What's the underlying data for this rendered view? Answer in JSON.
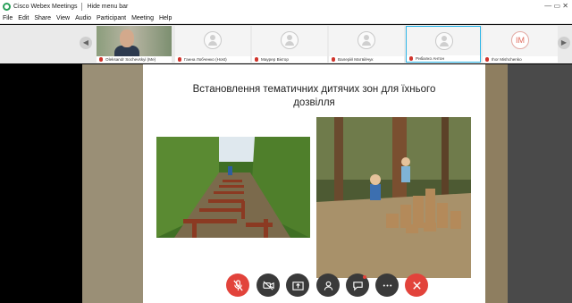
{
  "window": {
    "app_title": "Cisco Webex Meetings",
    "hide_menu_label": "Hide menu bar",
    "controls": "— ▭ ✕"
  },
  "menu": [
    "File",
    "Edit",
    "Share",
    "View",
    "Audio",
    "Participant",
    "Meeting",
    "Help"
  ],
  "participants": [
    {
      "name": "Oleksandr Sochevskyi (Me)",
      "type": "video",
      "muted": true
    },
    {
      "name": "Ганна Лобченко (Host)",
      "type": "avatar",
      "muted": true
    },
    {
      "name": "Маурер Віктор",
      "type": "avatar",
      "muted": true
    },
    {
      "name": "Валерій Матвійчук",
      "type": "avatar",
      "muted": true
    },
    {
      "name": "Рибалко Антон",
      "type": "avatar",
      "muted": true,
      "active": true
    },
    {
      "name": "Ihor Mishchenko",
      "type": "initials",
      "initials": "IM",
      "muted": true
    }
  ],
  "slide": {
    "title_line1": "Встановлення тематичних дитячих зон для їхнього",
    "title_line2": "дозвілля"
  },
  "controls": [
    {
      "name": "unmute-button",
      "icon": "mic-off-icon",
      "style": "red"
    },
    {
      "name": "video-button",
      "icon": "video-off-icon",
      "style": "dark"
    },
    {
      "name": "share-button",
      "icon": "share-icon",
      "style": "dark"
    },
    {
      "name": "participants-button",
      "icon": "person-icon",
      "style": "dark"
    },
    {
      "name": "chat-button",
      "icon": "chat-icon",
      "style": "dark"
    },
    {
      "name": "more-button",
      "icon": "more-icon",
      "style": "dark"
    },
    {
      "name": "leave-button",
      "icon": "close-icon",
      "style": "red"
    }
  ],
  "colors": {
    "accent": "#2cb6e8",
    "danger": "#e2433b"
  }
}
